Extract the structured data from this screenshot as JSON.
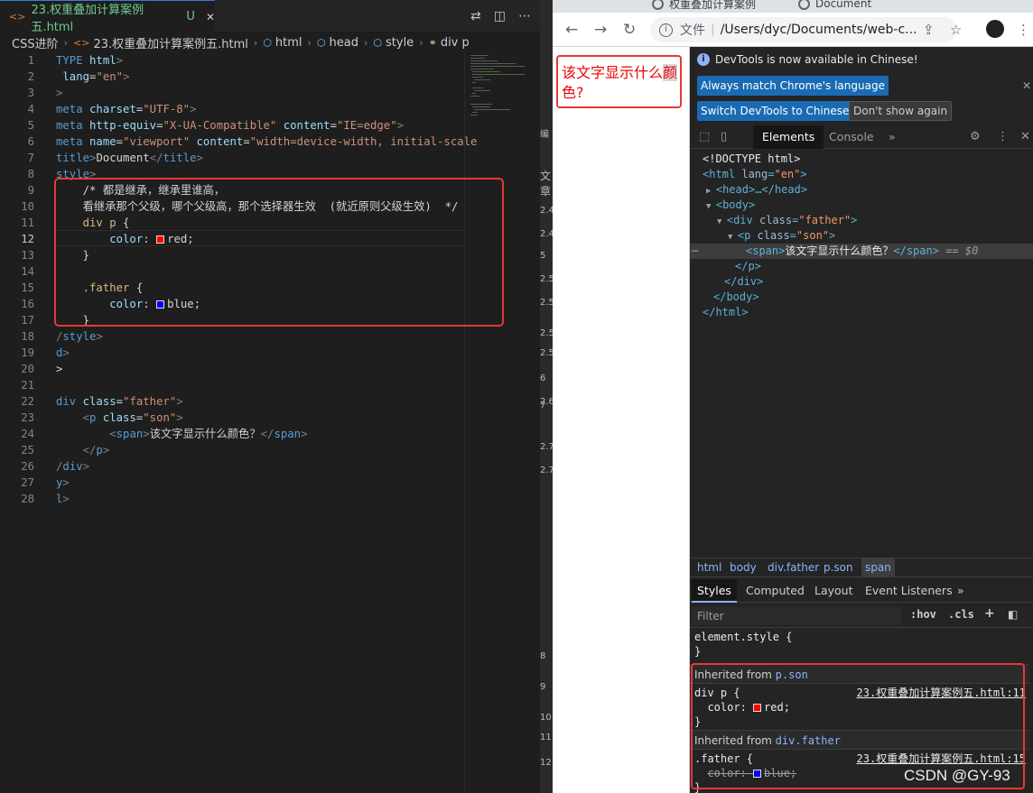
{
  "editor": {
    "tab": {
      "icon": "<>",
      "filename": "23.权重叠加计算案例五.html",
      "status": "U",
      "close": "✕"
    },
    "breadcrumb": [
      "CSS进阶",
      "23.权重叠加计算案例五.html",
      "html",
      "head",
      "style",
      "div p"
    ],
    "lines": [
      {
        "n": "1"
      },
      {
        "n": "2"
      },
      {
        "n": "3"
      },
      {
        "n": "4"
      },
      {
        "n": "5"
      },
      {
        "n": "6"
      },
      {
        "n": "7"
      },
      {
        "n": "8"
      },
      {
        "n": "9"
      },
      {
        "n": "10"
      },
      {
        "n": "11"
      },
      {
        "n": "12"
      },
      {
        "n": "13"
      },
      {
        "n": "14"
      },
      {
        "n": "15"
      },
      {
        "n": "16"
      },
      {
        "n": "17"
      },
      {
        "n": "18"
      },
      {
        "n": "19"
      },
      {
        "n": "20"
      },
      {
        "n": "21"
      },
      {
        "n": "22"
      },
      {
        "n": "23"
      },
      {
        "n": "24"
      },
      {
        "n": "25"
      },
      {
        "n": "26"
      },
      {
        "n": "27"
      },
      {
        "n": "28"
      }
    ],
    "current_line": "12",
    "code": {
      "l1a": "TYPE",
      "l1b": " html",
      "l1c": ">",
      "l2a": " lang",
      "l2b": "=",
      "l2c": "\"en\"",
      "l2d": ">",
      "l3": ">",
      "l5a": "meta",
      "l5b": " charset",
      "l5c": "=",
      "l5d": "\"UTF-8\"",
      "l5e": ">",
      "l6a": "meta",
      "l6b": " http-equiv",
      "l6c": "=",
      "l6d": "\"X-UA-Compatible\"",
      "l6e": " content",
      "l6f": "=",
      "l6g": "\"IE=edge\"",
      "l6h": ">",
      "l7a": "meta",
      "l7b": " name",
      "l7c": "=",
      "l7d": "\"viewport\"",
      "l7e": " content",
      "l7f": "=",
      "l7g": "\"width=device-width, initial-scale",
      "l8a": "title",
      "l8b": ">",
      "l8c": "Document",
      "l8d": "</",
      "l8e": "title",
      "l8f": ">",
      "l9": "style",
      "l9b": ">",
      "c1": "    /* 都是继承，继承里谁高，",
      "c2": "    看继承那个父级，哪个父级高，那个选择器生效  (就近原则父级生效)  */",
      "s1": "    div p ",
      "s1b": "{",
      "p1": "        color",
      "p1b": ": ",
      "v1": "red",
      "p1c": ";",
      "s1c": "    }",
      "s2": "    .father ",
      "s2b": "{",
      "p2": "        color",
      "p2b": ": ",
      "v2": "blue",
      "p2c": ";",
      "s2c": "    }",
      "l18a": "/",
      "l18b": "style",
      "l18c": ">",
      "l19a": "d",
      "l19b": ">",
      "l20": ">",
      "l22a": "div",
      "l22b": " class",
      "l22c": "=",
      "l22d": "\"father\"",
      "l22e": ">",
      "l23a": "    <",
      "l23b": "p",
      "l23c": " class",
      "l23d": "=",
      "l23e": "\"son\"",
      "l23f": ">",
      "l24a": "        <",
      "l24b": "span",
      "l24c": ">",
      "l24d": "该文字显示什么颜色？",
      "l24e": "</",
      "l24f": "span",
      "l24g": ">",
      "l25a": "    </",
      "l25b": "p",
      "l25c": ">",
      "l26a": "/",
      "l26b": "div",
      "l26c": ">",
      "l27a": "y",
      "l27b": ">",
      "l28a": "l",
      "l28b": ">"
    }
  },
  "strip": [
    "2.4",
    "2.4",
    "5",
    "2.5",
    "2.5",
    "2.5",
    "2.5",
    "6",
    "2.6",
    "7",
    "2.7",
    "2.7",
    "8",
    "9",
    "10",
    "11",
    "12"
  ],
  "strip_top": {
    "a": "编",
    "b": "文章"
  },
  "chrome": {
    "tab1": "权重叠加计算案例",
    "tab2": "Document",
    "url_label": "文件",
    "url": "/Users/dyc/Documents/web-c...",
    "page_text_a": "该文字显示什么",
    "page_text_hl": "颜",
    "page_text_b": "色?"
  },
  "devtools": {
    "notice": "DevTools is now available in Chinese!",
    "btn_match": "Always match Chrome's language",
    "btn_switch": "Switch DevTools to Chinese",
    "btn_dont": "Don't show again",
    "tabs": {
      "elements": "Elements",
      "console": "Console",
      "more": "»"
    },
    "dom": {
      "doctype": "<!DOCTYPE html>",
      "html_open_a": "<html",
      "html_attr": " lang",
      "html_eq": "=",
      "html_val": "\"en\"",
      "html_close": ">",
      "head": "<head>…</head>",
      "body_open": "<body>",
      "div_open_a": "<div",
      "div_attr": " class",
      "div_eq": "=",
      "div_val": "\"father\"",
      "div_close": ">",
      "p_open_a": "<p",
      "p_attr": " class",
      "p_eq": "=",
      "p_val": "\"son\"",
      "p_close": ">",
      "span_open": "<span>",
      "span_text": "该文字显示什么颜色？",
      "span_close": "</span>",
      "span_eq": " == ",
      "span_ref": "$0",
      "p_end": "</p>",
      "div_end": "</div>",
      "body_end": "</body>",
      "html_end": "</html>"
    },
    "path": [
      "html",
      "body",
      "div.father",
      "p.son",
      "span"
    ],
    "style_tabs": [
      "Styles",
      "Computed",
      "Layout",
      "Event Listeners",
      "»"
    ],
    "filter_placeholder": "Filter",
    "hov": ":hov",
    "cls": ".cls",
    "plus": "+",
    "element_style": "element.style {",
    "element_style_close": "}",
    "inherited1_label": "Inherited from ",
    "inherited1_ref": "p.son",
    "rule1_sel": "div p {",
    "rule1_src": "23.权重叠加计算案例五.html:11",
    "rule1_prop": "  color: ",
    "rule1_val": "red;",
    "rule1_close": "}",
    "inherited2_label": "Inherited from ",
    "inherited2_ref": "div.father",
    "rule2_sel": ".father {",
    "rule2_src": "23.权重叠加计算案例五.html:15",
    "rule2_prop": "color: ",
    "rule2_val": "blue;",
    "rule2_close": "}"
  },
  "watermark": "CSDN @GY-93",
  "colors": {
    "red": "#ff0000",
    "blue": "#0000ff",
    "highlight": "#e53935"
  }
}
